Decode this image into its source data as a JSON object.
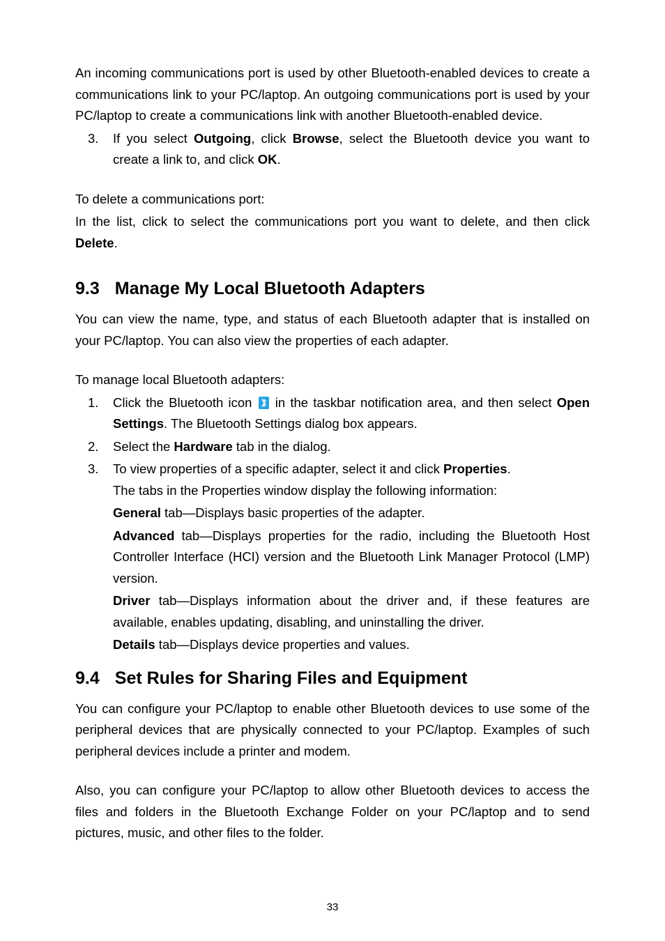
{
  "intro": {
    "li_text": "An incoming communications port is used by other Bluetooth-enabled devices to create a communications link to your PC/laptop. An outgoing communications port is used by your PC/laptop to create a communications link with another Bluetooth-enabled device.",
    "li3_num": "3.",
    "li3_a": "If you select ",
    "li3_b": "Outgoing",
    "li3_c": ", click ",
    "li3_d": "Browse",
    "li3_e": ", select the Bluetooth device you want to create a link to, and click ",
    "li3_f": "OK",
    "li3_g": "."
  },
  "delete": {
    "p1": "To delete a communications port:",
    "p2a": "In the list, click to select the communications port you want to delete, and then click ",
    "p2b": "Delete",
    "p2c": "."
  },
  "sec93": {
    "num": "9.3",
    "title": "Manage My Local Bluetooth Adapters",
    "p1": "You can view the name, type, and status of each Bluetooth adapter that is installed on your PC/laptop. You can also view the properties of each adapter.",
    "p2": "To manage local Bluetooth adapters:",
    "li1_num": "1.",
    "li1_a": "Click the Bluetooth icon ",
    "li1_b": " in the taskbar notification area, and then select ",
    "li1_c": "Open Settings",
    "li1_d": ". The Bluetooth Settings dialog box appears.",
    "li2_num": "2.",
    "li2_a": "Select the ",
    "li2_b": "Hardware",
    "li2_c": " tab in the dialog.",
    "li3_num": "3.",
    "li3_a": "To view properties of a specific adapter, select it and click ",
    "li3_b": "Properties",
    "li3_c": ".",
    "li3_d": "The tabs in the Properties window display the following information:",
    "gen_a": "General",
    "gen_b": " tab—Displays basic properties of the adapter.",
    "adv_a": "Advanced",
    "adv_b": " tab—Displays properties for the radio, including the Bluetooth Host Controller Interface (HCI) version and the Bluetooth Link Manager Protocol (LMP) version.",
    "drv_a": "Driver",
    "drv_b": " tab—Displays information about the driver and, if these features are available, enables updating, disabling, and uninstalling the driver.",
    "det_a": "Details",
    "det_b": " tab—Displays device properties and values."
  },
  "sec94": {
    "num": "9.4",
    "title": "Set Rules for Sharing Files and Equipment",
    "p1": "You can configure your PC/laptop to enable other Bluetooth devices to use some of the peripheral devices that are physically connected to your PC/laptop. Examples of such peripheral devices include a printer and modem.",
    "p2": "Also, you can configure your PC/laptop to allow other Bluetooth devices to access the files and folders in the Bluetooth Exchange Folder on your PC/laptop and to send pictures, music, and other files to the folder."
  },
  "pagenum": "33"
}
